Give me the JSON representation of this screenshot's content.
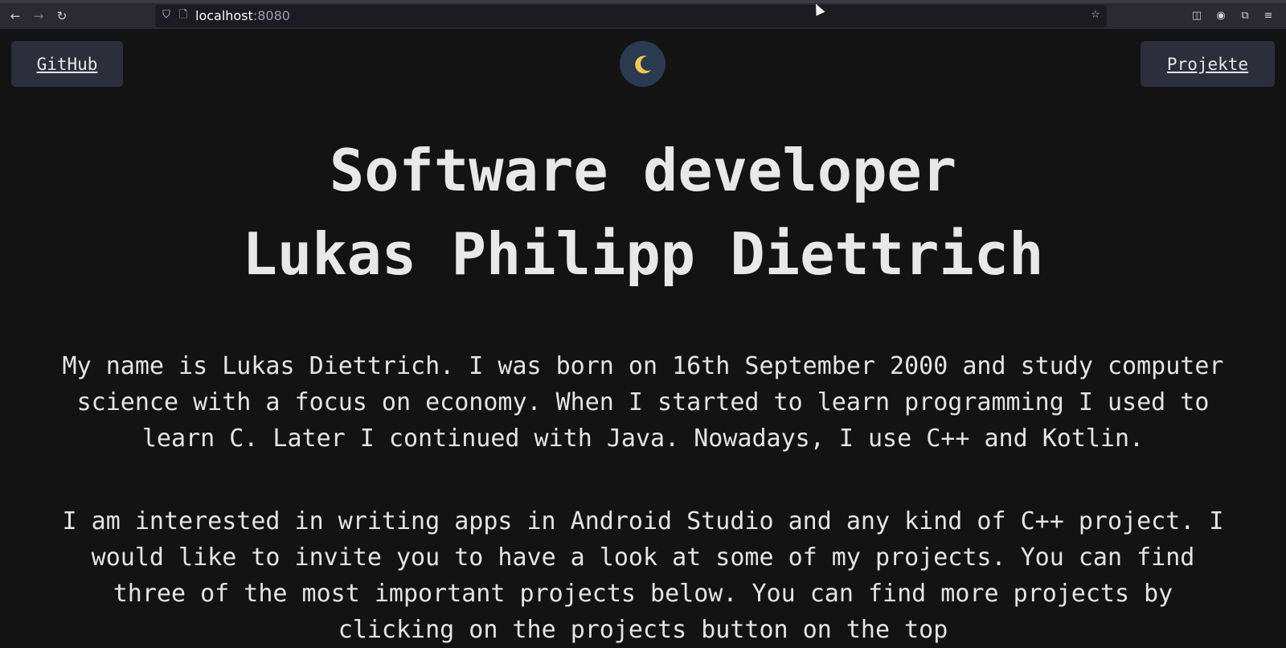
{
  "browser": {
    "url_host": "localhost",
    "url_port": ":8080",
    "icons": [
      "back-icon",
      "forward-icon",
      "reload-icon",
      "shield-icon",
      "page-icon",
      "bookmark-star-icon",
      "pocket-icon",
      "account-icon",
      "extensions-icon",
      "menu-icon"
    ]
  },
  "nav": {
    "github_label": "GitHub",
    "projects_label": "Projekte",
    "theme_toggle_icon": "moon-icon",
    "theme_glyph": "🌙"
  },
  "hero": {
    "line1": "Software developer",
    "line2": "Lukas Philipp Diettrich"
  },
  "about": {
    "paragraph1": "My name is Lukas Diettrich. I was born on 16th September 2000 and study computer science with a focus on economy. When I started to learn programming I used to learn C. Later I continued with Java. Nowadays, I use C++ and Kotlin.",
    "paragraph2": "I am interested in writing apps in Android Studio and any kind of C++ project. I would like to invite you to have a look at some of my projects. You can find three of the most important projects below. You can find more projects by clicking on the projects button on the top"
  },
  "colors": {
    "background": "#131313",
    "button_bg": "#2d2e3b",
    "toggle_bg": "#2a3a50",
    "moon": "#f2c94c"
  }
}
